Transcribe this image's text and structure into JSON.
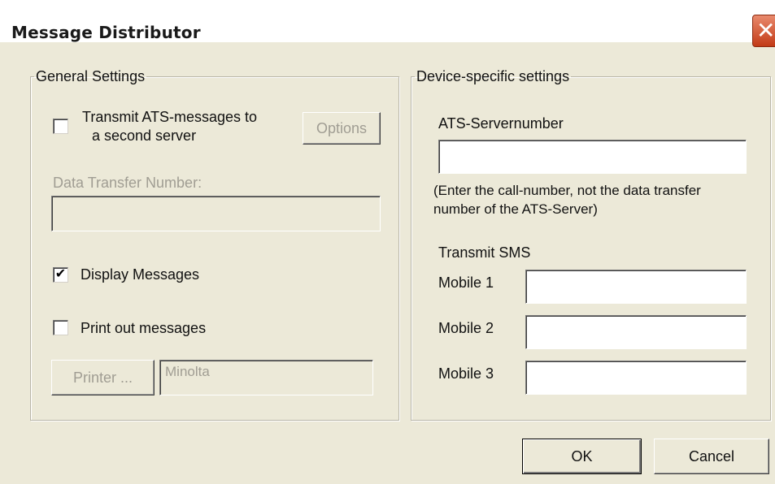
{
  "window": {
    "title": "Message Distributor",
    "close_glyph": "✕"
  },
  "general": {
    "legend": "General Settings",
    "transmit_line1": "Transmit ATS-messages to",
    "transmit_line2": "a second server",
    "transmit_checked": false,
    "options_label": "Options",
    "data_transfer_label": "Data Transfer Number:",
    "data_transfer_value": "",
    "display_label": "Display Messages",
    "display_checked": true,
    "display_check_glyph": "✔",
    "print_label": "Print out messages",
    "print_checked": false,
    "printer_button": "Printer ...",
    "printer_value": "Minolta"
  },
  "device": {
    "legend": "Device-specific settings",
    "server_label": "ATS-Servernumber",
    "server_value": "",
    "hint_line1": "(Enter the call-number, not the data transfer",
    "hint_line2": "number of the ATS-Server)",
    "sms_label": "Transmit SMS",
    "mobile1_label": "Mobile 1",
    "mobile1_value": "",
    "mobile2_label": "Mobile 2",
    "mobile2_value": "",
    "mobile3_label": "Mobile 3",
    "mobile3_value": ""
  },
  "footer": {
    "ok_label": "OK",
    "cancel_label": "Cancel"
  }
}
